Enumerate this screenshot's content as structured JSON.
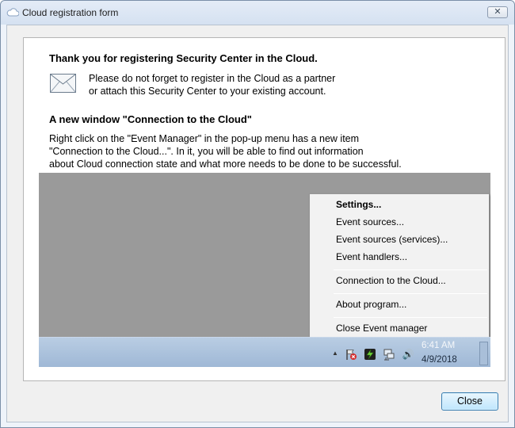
{
  "window": {
    "title": "Cloud registration form",
    "close_glyph": "✕",
    "icon": "cloud-icon"
  },
  "content": {
    "heading1": "Thank you for registering Security Center in the Cloud.",
    "note_line1": "Please do not forget to register in the Cloud as a partner",
    "note_line2": "or attach this Security Center to your existing account.",
    "envelope_icon": "envelope-icon",
    "heading2": "A new window \"Connection to the Cloud\"",
    "desc_line1": "Right click on the \"Event Manager\" in the pop-up menu has a new item",
    "desc_line2": "\"Connection to the Cloud...\". In it, you will be able to find out information",
    "desc_line3": "about Cloud connection state and what more needs to be done to be successful."
  },
  "illustration": {
    "menu": {
      "items": [
        "Settings...",
        "Event sources...",
        "Event sources (services)...",
        "Event handlers...",
        "Connection to the Cloud...",
        "About program...",
        "Close Event manager"
      ]
    },
    "tray": {
      "time": "6:41 AM",
      "date": "4/9/2018",
      "up_arrow": "▲",
      "volume_glyph": "🔊"
    }
  },
  "buttons": {
    "close_label": "Close"
  },
  "colors": {
    "accent": "#3c7fb1",
    "panel_bg": "#ffffff",
    "illustration_bg": "#9a9a9a",
    "taskbar": "#a8c0dc"
  }
}
